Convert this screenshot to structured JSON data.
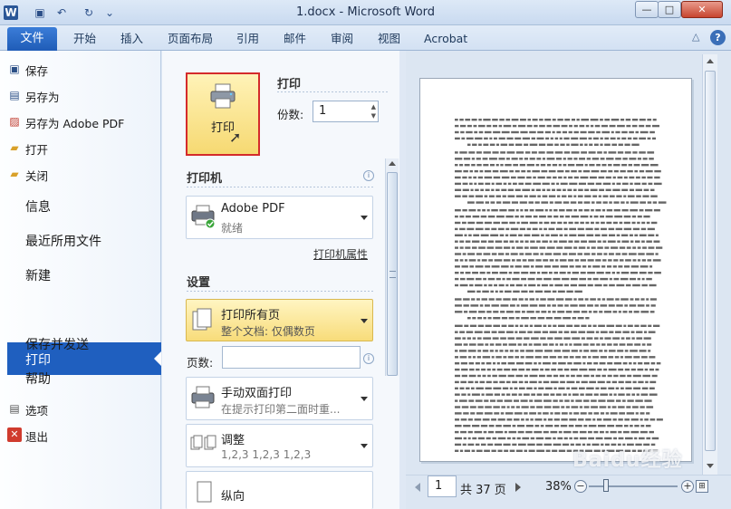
{
  "window": {
    "title": "1.docx - Microsoft Word",
    "app_icon": "W",
    "controls": {
      "minimize": "—",
      "maximize": "□",
      "close": "✕"
    }
  },
  "quick_access": {
    "icons": [
      "save-icon",
      "undo-icon",
      "redo-icon",
      "customize-icon"
    ]
  },
  "ribbon_tabs": [
    {
      "label": "文件",
      "active": true
    },
    {
      "label": "开始"
    },
    {
      "label": "插入"
    },
    {
      "label": "页面布局"
    },
    {
      "label": "引用"
    },
    {
      "label": "邮件"
    },
    {
      "label": "审阅"
    },
    {
      "label": "视图"
    },
    {
      "label": "Acrobat"
    }
  ],
  "left_menu": {
    "commands": [
      {
        "label": "保存",
        "icon": "save-icon"
      },
      {
        "label": "另存为",
        "icon": "save-as-icon"
      },
      {
        "label": "另存为 Adobe PDF",
        "icon": "pdf-icon"
      },
      {
        "label": "打开",
        "icon": "open-folder-icon"
      },
      {
        "label": "关闭",
        "icon": "close-folder-icon"
      }
    ],
    "sections": [
      "信息",
      "最近所用文件",
      "新建",
      "打印",
      "保存并发送",
      "帮助"
    ],
    "active_section": "打印",
    "bottom": [
      {
        "label": "选项",
        "icon": "options-icon"
      },
      {
        "label": "退出",
        "icon": "exit-icon"
      }
    ]
  },
  "print_panel": {
    "print_button_label": "打印",
    "heading": "打印",
    "copies_label": "份数:",
    "copies_value": "1",
    "printer_heading": "打印机",
    "printer": {
      "name": "Adobe PDF",
      "status": "就绪"
    },
    "printer_properties_link": "打印机属性",
    "settings_heading": "设置",
    "settings": [
      {
        "title": "打印所有页",
        "sub": "整个文档: 仅偶数页",
        "highlighted": true
      },
      {
        "title": "手动双面打印",
        "sub": "在提示打印第二面时重..."
      },
      {
        "title": "调整",
        "sub": "1,2,3     1,2,3     1,2,3"
      },
      {
        "title": "纵向",
        "sub": ""
      }
    ],
    "pages_label": "页数:",
    "pages_value": ""
  },
  "preview": {
    "current_page": "1",
    "total_pages": "共 37 页",
    "zoom": "38%"
  },
  "watermark": "Baidu经验",
  "colors": {
    "accent": "#1f5fbf",
    "highlight": "#f6d972",
    "border_red": "#d42b2b"
  }
}
